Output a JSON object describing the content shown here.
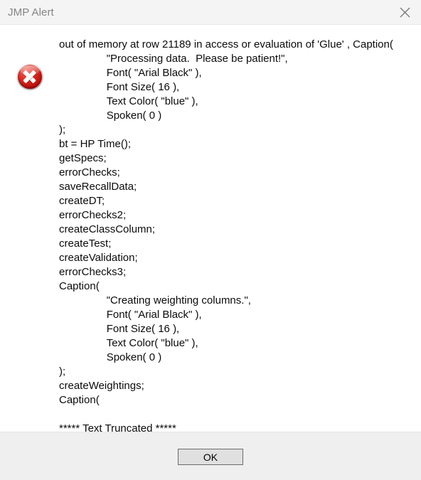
{
  "window": {
    "title": "JMP Alert",
    "close_icon": "close-icon",
    "title_color": "#848484",
    "titlebar_bg": "#f4f4f4"
  },
  "alert": {
    "icon": "error-icon",
    "icon_color": "#cc1a13",
    "message": "out of memory at row 21189 in access or evaluation of 'Glue' , Caption(\n\t\t\"Processing data.  Please be patient!\",\n\t\tFont( \"Arial Black\" ),\n\t\tFont Size( 16 ),\n\t\tText Color( \"blue\" ),\n\t\tSpoken( 0 )\n);\nbt = HP Time();\ngetSpecs;\nerrorChecks;\nsaveRecallData;\ncreateDT;\nerrorChecks2;\ncreateClassColumn;\ncreateTest;\ncreateValidation;\nerrorChecks3;\nCaption(\n\t\t\"Creating weighting columns.\",\n\t\tFont( \"Arial Black\" ),\n\t\tFont Size( 16 ),\n\t\tText Color( \"blue\" ),\n\t\tSpoken( 0 )\n);\ncreateWeightings;\nCaption(\n\n***** Text Truncated *****"
  },
  "footer": {
    "ok_label": "OK",
    "button_bg": "#e0e0e0",
    "panel_bg": "#efefef"
  }
}
